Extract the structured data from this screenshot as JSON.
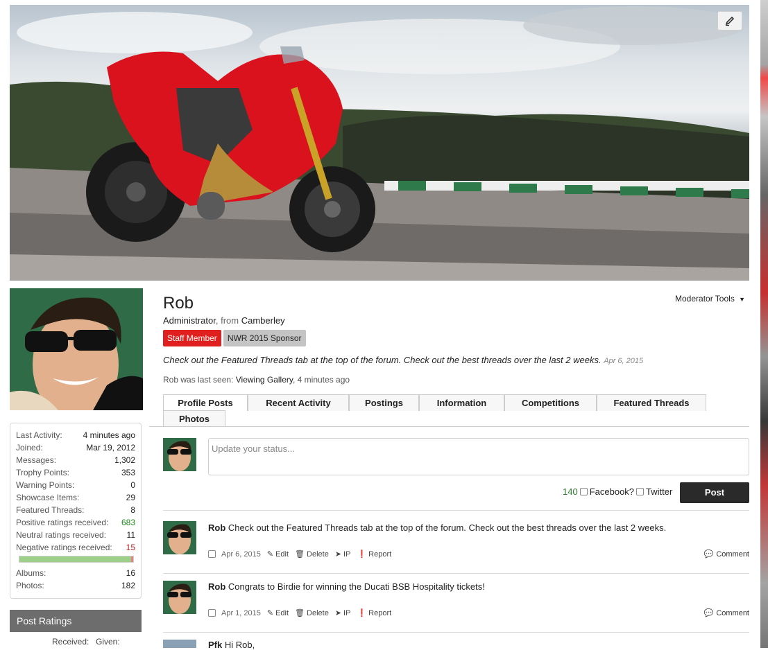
{
  "profile": {
    "username": "Rob",
    "role": "Administrator",
    "from_label": ", from ",
    "location": "Camberley",
    "badges": [
      "Staff Member",
      "NWR 2015 Sponsor"
    ],
    "status_text": "Check out the Featured Threads tab at the top of the forum. Check out the best threads over the last 2 weeks.",
    "status_date": "Apr 6, 2015",
    "last_seen_prefix": "Rob was last seen:",
    "last_seen_activity": "Viewing Gallery",
    "last_seen_time": ", 4 minutes ago",
    "moderator_tools": "Moderator Tools"
  },
  "tabs": [
    "Profile Posts",
    "Recent Activity",
    "Postings",
    "Information",
    "Competitions",
    "Featured Threads",
    "Photos"
  ],
  "stats": [
    {
      "label": "Last Activity:",
      "value": "4 minutes ago"
    },
    {
      "label": "Joined:",
      "value": "Mar 19, 2012"
    },
    {
      "label": "Messages:",
      "value": "1,302"
    },
    {
      "label": "Trophy Points:",
      "value": "353"
    },
    {
      "label": "Warning Points:",
      "value": "0"
    },
    {
      "label": "Showcase Items:",
      "value": "29"
    },
    {
      "label": "Featured Threads:",
      "value": "8"
    },
    {
      "label": "Positive ratings received:",
      "value": "683"
    },
    {
      "label": "Neutral ratings received:",
      "value": "11"
    },
    {
      "label": "Negative ratings received:",
      "value": "15"
    }
  ],
  "rating_bar": {
    "positive_fraction": 0.962,
    "negative_fraction": 0.021
  },
  "stats_after": [
    {
      "label": "Albums:",
      "value": "16"
    },
    {
      "label": "Photos:",
      "value": "182"
    }
  ],
  "post_ratings": {
    "title": "Post Ratings",
    "received": "Received:",
    "given": "Given:"
  },
  "composer": {
    "placeholder": "Update your status...",
    "counter": "140",
    "facebook": "Facebook?",
    "twitter": "Twitter",
    "post_button": "Post"
  },
  "posts": [
    {
      "author": "Rob",
      "text": " Check out the Featured Threads tab at the top of the forum. Check out the best threads over the last 2 weeks.",
      "date": "Apr 6, 2015"
    },
    {
      "author": "Rob",
      "text": " Congrats to Birdie for winning the Ducati BSB Hospitality tickets!",
      "date": "Apr 1, 2015"
    },
    {
      "author": "Pfk",
      "text": " Hi Rob,",
      "date": ""
    }
  ],
  "post_actions": {
    "edit": "Edit",
    "delete": "Delete",
    "ip": "IP",
    "report": "Report",
    "comment": "Comment"
  },
  "colors": {
    "staff_badge": "#e0201e",
    "post_button": "#2a2a2a",
    "positive": "#1a8a1a",
    "negative": "#c02020"
  }
}
